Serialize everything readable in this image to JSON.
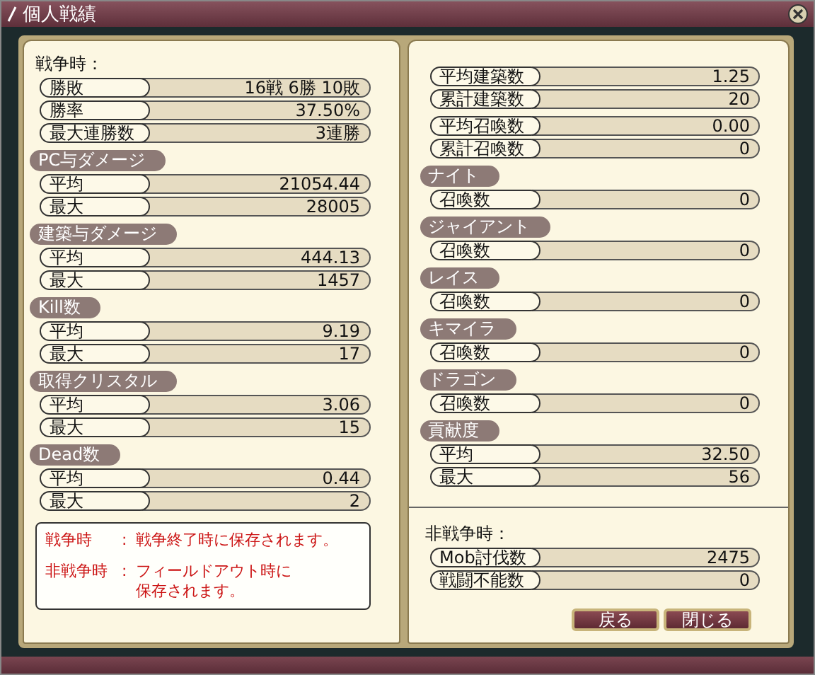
{
  "window": {
    "title": "個人戦績"
  },
  "left": {
    "heading": "戦争時：",
    "sections": [
      {
        "rows": [
          {
            "label": "勝敗",
            "value": "16戦 6勝 10敗"
          },
          {
            "label": "勝率",
            "value": "37.50%"
          },
          {
            "label": "最大連勝数",
            "value": "3連勝"
          }
        ]
      },
      {
        "title": "PC与ダメージ",
        "rows": [
          {
            "label": "平均",
            "value": "21054.44"
          },
          {
            "label": "最大",
            "value": "28005"
          }
        ]
      },
      {
        "title": "建築与ダメージ",
        "rows": [
          {
            "label": "平均",
            "value": "444.13"
          },
          {
            "label": "最大",
            "value": "1457"
          }
        ]
      },
      {
        "title": "Kill数",
        "rows": [
          {
            "label": "平均",
            "value": "9.19"
          },
          {
            "label": "最大",
            "value": "17"
          }
        ]
      },
      {
        "title": "取得クリスタル",
        "rows": [
          {
            "label": "平均",
            "value": "3.06"
          },
          {
            "label": "最大",
            "value": "15"
          }
        ]
      },
      {
        "title": "Dead数",
        "rows": [
          {
            "label": "平均",
            "value": "0.44"
          },
          {
            "label": "最大",
            "value": "2"
          }
        ]
      }
    ],
    "notes": [
      {
        "term": "戦争時",
        "separator": ":",
        "lines": [
          "戦争終了時に保存されます。"
        ]
      },
      {
        "term": "非戦争時",
        "separator": ":",
        "lines": [
          "フィールドアウト時に",
          "保存されます。"
        ]
      }
    ]
  },
  "right": {
    "sections": [
      {
        "rows": [
          {
            "label": "平均建築数",
            "value": "1.25"
          },
          {
            "label": "累計建築数",
            "value": "20"
          }
        ]
      },
      {
        "rows": [
          {
            "label": "平均召喚数",
            "value": "0.00"
          },
          {
            "label": "累計召喚数",
            "value": "0"
          }
        ]
      },
      {
        "title": "ナイト",
        "rows": [
          {
            "label": "召喚数",
            "value": "0"
          }
        ]
      },
      {
        "title": "ジャイアント",
        "rows": [
          {
            "label": "召喚数",
            "value": "0"
          }
        ]
      },
      {
        "title": "レイス",
        "rows": [
          {
            "label": "召喚数",
            "value": "0"
          }
        ]
      },
      {
        "title": "キマイラ",
        "rows": [
          {
            "label": "召喚数",
            "value": "0"
          }
        ]
      },
      {
        "title": "ドラゴン",
        "rows": [
          {
            "label": "召喚数",
            "value": "0"
          }
        ]
      },
      {
        "title": "貢献度",
        "rows": [
          {
            "label": "平均",
            "value": "32.50"
          },
          {
            "label": "最大",
            "value": "56"
          }
        ]
      }
    ],
    "peace": {
      "heading": "非戦争時：",
      "rows": [
        {
          "label": "Mob討伐数",
          "value": "2475"
        },
        {
          "label": "戦闘不能数",
          "value": "0"
        }
      ]
    }
  },
  "buttons": [
    "戻る",
    "閉じる"
  ]
}
